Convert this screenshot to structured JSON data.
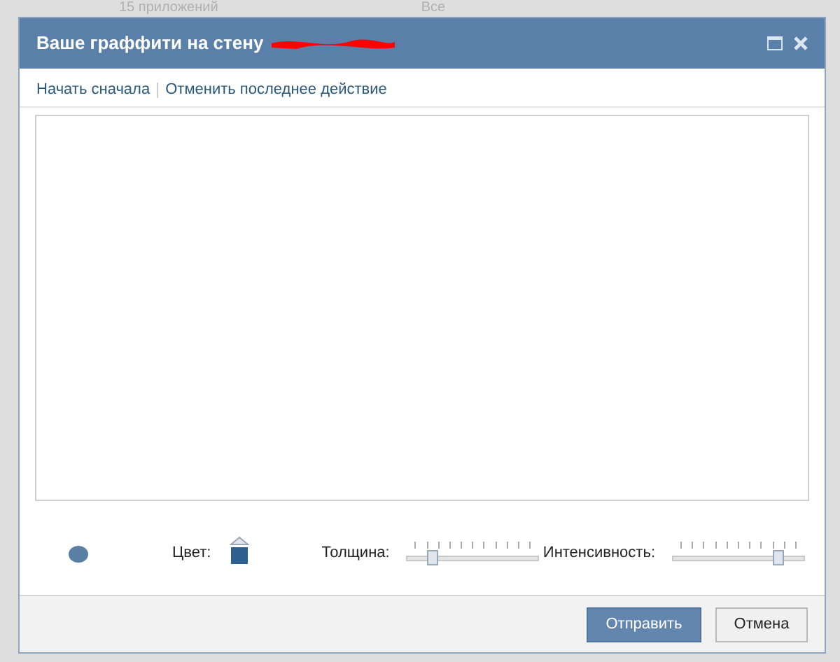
{
  "background": {
    "texts": [
      "15 приложений",
      "Все"
    ]
  },
  "dialog": {
    "title": "Ваше граффити на стену",
    "actions": [
      "Начать сначала",
      "Отменить последнее действие"
    ],
    "tools": {
      "color_label": "Цвет:",
      "color": "#2f5f8f",
      "sliders": [
        {
          "label": "Толщина:",
          "level": 0.2
        },
        {
          "label": "Интенсивность:",
          "level": 0.8
        }
      ]
    },
    "buttons": [
      {
        "label": "Отправить",
        "kind": "primary"
      },
      {
        "label": "Отмена",
        "kind": "secondary"
      }
    ]
  }
}
